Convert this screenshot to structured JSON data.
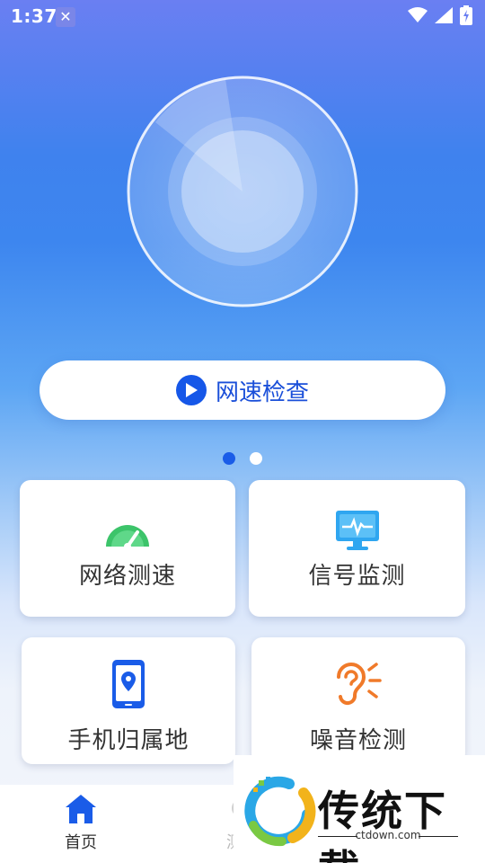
{
  "status_bar": {
    "time": "1:37"
  },
  "main": {
    "speed_check_label": "网速检查"
  },
  "pager": {
    "active_index": 0,
    "count": 2
  },
  "features": [
    {
      "label": "网络测速",
      "icon": "speedometer-icon"
    },
    {
      "label": "信号监测",
      "icon": "monitor-pulse-icon"
    },
    {
      "label": "手机归属地",
      "icon": "phone-location-icon"
    },
    {
      "label": "噪音检测",
      "icon": "ear-sound-icon"
    }
  ],
  "bottom_nav": {
    "items": [
      {
        "label": "首页",
        "icon": "home-icon",
        "active": true
      },
      {
        "label": "测",
        "icon": "tab2-icon",
        "active": false
      }
    ]
  },
  "watermark": {
    "title": "传统下载",
    "subtitle": "ctdown.com"
  },
  "colors": {
    "accent": "#1a5ce8",
    "speed_green": "#3cc46a",
    "ear_orange": "#f07a2a"
  }
}
